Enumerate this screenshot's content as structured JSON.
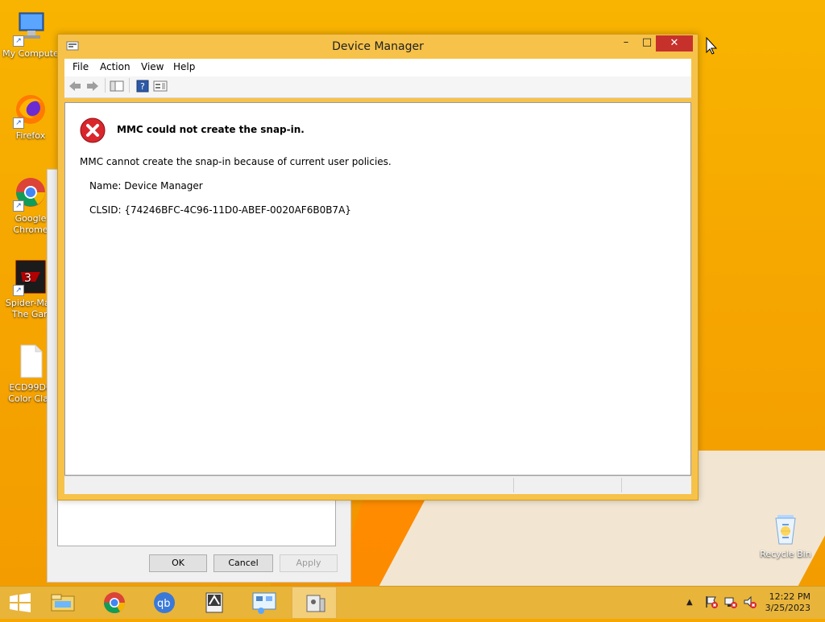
{
  "desktop": {
    "icons": [
      {
        "label": "My Compute",
        "name": "my-computer"
      },
      {
        "label": "Firefox",
        "name": "firefox"
      },
      {
        "label": "Google Chrome",
        "name": "google-chrome"
      },
      {
        "label": "Spider-Ma - The Gan",
        "name": "spider-man-game"
      },
      {
        "label": "ECD99DC Color Clas",
        "name": "ecd99dc-file"
      },
      {
        "label": "Recycle Bin",
        "name": "recycle-bin"
      }
    ]
  },
  "background_dialog": {
    "ok_label": "OK",
    "cancel_label": "Cancel",
    "apply_label": "Apply"
  },
  "window": {
    "title": "Device Manager",
    "minimize_glyph": "–",
    "maximize_glyph": "□",
    "close_glyph": "✕",
    "menu": [
      "File",
      "Action",
      "View",
      "Help"
    ],
    "toolbar_icons": [
      "back-arrow-icon",
      "forward-arrow-icon",
      "show-hide-console-tree-icon",
      "help-icon",
      "properties-icon"
    ]
  },
  "error": {
    "heading": "MMC could not create the snap-in.",
    "message": "MMC cannot create the snap-in because of current user policies.",
    "name_line": "Name: Device Manager",
    "clsid_line": "CLSID: {74246BFC-4C96-11D0-ABEF-0020AF6B0B7A}"
  },
  "taskbar": {
    "time": "12:22 PM",
    "date": "3/25/2023",
    "apps": [
      "file-explorer",
      "google-chrome",
      "qbittorrent",
      "app-tool",
      "control-panel",
      "device-manager"
    ]
  },
  "colors": {
    "desktop": "#f6a800",
    "window_frame": "#f6c24a",
    "close_button": "#c7312b",
    "taskbar": "#e8b43a"
  }
}
